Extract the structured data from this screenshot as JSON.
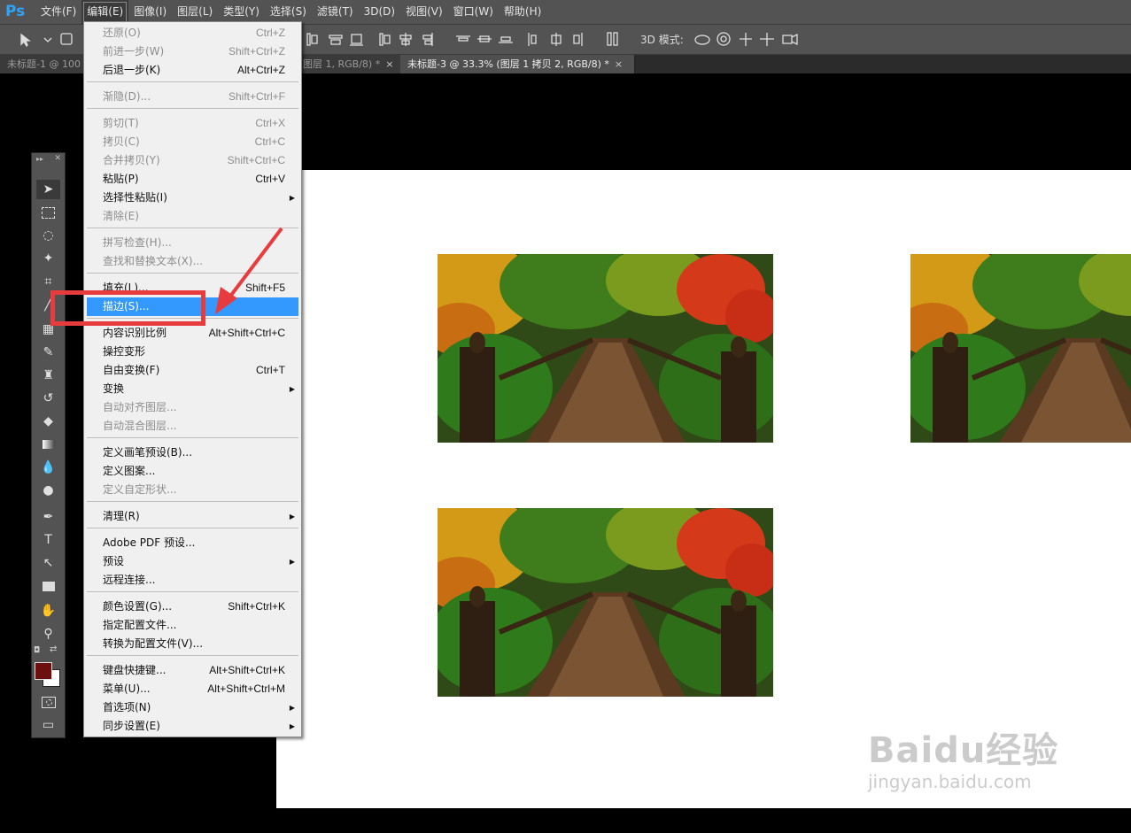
{
  "app": {
    "logo_text": "Ps"
  },
  "menubar": {
    "items": [
      "文件(F)",
      "编辑(E)",
      "图像(I)",
      "图层(L)",
      "类型(Y)",
      "选择(S)",
      "滤镜(T)",
      "3D(D)",
      "视图(V)",
      "窗口(W)",
      "帮助(H)"
    ],
    "active_index": 1
  },
  "options_bar": {
    "mode_3d_label": "3D 模式:"
  },
  "tabs": [
    {
      "label": "未标题-1 @ 100"
    },
    {
      "label": "图层 1, RGB/8) *"
    },
    {
      "label": "未标题-3 @ 33.3% (图层 1 拷贝 2, RGB/8) *",
      "active": true
    }
  ],
  "edit_menu": {
    "items": [
      {
        "label": "还原(O)",
        "shortcut": "Ctrl+Z",
        "disabled": true
      },
      {
        "label": "前进一步(W)",
        "shortcut": "Shift+Ctrl+Z",
        "disabled": true
      },
      {
        "label": "后退一步(K)",
        "shortcut": "Alt+Ctrl+Z"
      },
      {
        "label": "渐隐(D)...",
        "shortcut": "Shift+Ctrl+F",
        "disabled": true
      },
      {
        "label": "剪切(T)",
        "shortcut": "Ctrl+X",
        "disabled": true
      },
      {
        "label": "拷贝(C)",
        "shortcut": "Ctrl+C",
        "disabled": true
      },
      {
        "label": "合并拷贝(Y)",
        "shortcut": "Shift+Ctrl+C",
        "disabled": true
      },
      {
        "label": "粘贴(P)",
        "shortcut": "Ctrl+V"
      },
      {
        "label": "选择性粘贴(I)",
        "shortcut": "",
        "submenu": true
      },
      {
        "label": "清除(E)",
        "shortcut": "",
        "disabled": true
      },
      {
        "label": "拼写检查(H)...",
        "shortcut": "",
        "disabled": true
      },
      {
        "label": "查找和替换文本(X)...",
        "shortcut": "",
        "disabled": true
      },
      {
        "label": "填充(L)...",
        "shortcut": "Shift+F5"
      },
      {
        "label": "描边(S)...",
        "shortcut": "",
        "highlighted": true
      },
      {
        "label": "内容识别比例",
        "shortcut": "Alt+Shift+Ctrl+C"
      },
      {
        "label": "操控变形",
        "shortcut": ""
      },
      {
        "label": "自由变换(F)",
        "shortcut": "Ctrl+T"
      },
      {
        "label": "变换",
        "shortcut": "",
        "submenu": true
      },
      {
        "label": "自动对齐图层...",
        "shortcut": "",
        "disabled": true
      },
      {
        "label": "自动混合图层...",
        "shortcut": "",
        "disabled": true
      },
      {
        "label": "定义画笔预设(B)...",
        "shortcut": ""
      },
      {
        "label": "定义图案...",
        "shortcut": ""
      },
      {
        "label": "定义自定形状...",
        "shortcut": "",
        "disabled": true
      },
      {
        "label": "清理(R)",
        "shortcut": "",
        "submenu": true
      },
      {
        "label": "Adobe PDF 预设...",
        "shortcut": ""
      },
      {
        "label": "预设",
        "shortcut": "",
        "submenu": true
      },
      {
        "label": "远程连接...",
        "shortcut": ""
      },
      {
        "label": "颜色设置(G)...",
        "shortcut": "Shift+Ctrl+K"
      },
      {
        "label": "指定配置文件...",
        "shortcut": ""
      },
      {
        "label": "转换为配置文件(V)...",
        "shortcut": ""
      },
      {
        "label": "键盘快捷键...",
        "shortcut": "Alt+Shift+Ctrl+K"
      },
      {
        "label": "菜单(U)...",
        "shortcut": "Alt+Shift+Ctrl+M"
      },
      {
        "label": "首选项(N)",
        "shortcut": "",
        "submenu": true
      },
      {
        "label": "同步设置(E)",
        "shortcut": "",
        "submenu": true
      }
    ]
  },
  "colors": {
    "foreground_color": "#6b0f0f",
    "background_color": "#ffffff",
    "highlight": "#3399ff",
    "annotation_red": "#e83b3e"
  },
  "watermark": {
    "brand": "Baidu经验",
    "url": "jingyan.baidu.com"
  }
}
